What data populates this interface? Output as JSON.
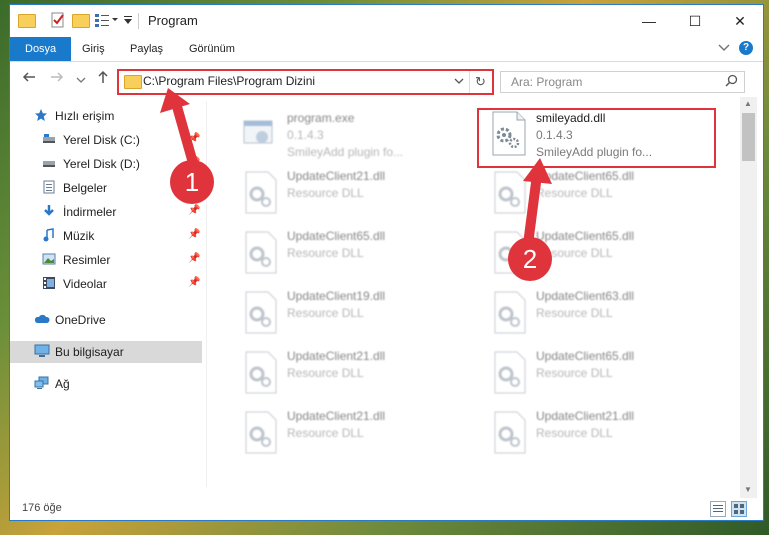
{
  "window": {
    "title": "Program"
  },
  "titlebar": {
    "minimize": "—",
    "maximize": "☐",
    "close": "✕"
  },
  "ribbon": {
    "tabs": [
      {
        "label": "Dosya"
      },
      {
        "label": "Giriş"
      },
      {
        "label": "Paylaş"
      },
      {
        "label": "Görünüm"
      }
    ],
    "collapse_icon": "chevron-down-icon",
    "help_label": "?"
  },
  "navbar": {
    "address_path": "C:\\Program Files\\Program Dizini",
    "search_placeholder": "Ara: Program"
  },
  "sidebar": {
    "items": [
      {
        "label": "Hızlı erişim",
        "icon": "star-icon"
      },
      {
        "label": "Yerel Disk (C:)",
        "icon": "drive-icon"
      },
      {
        "label": "Yerel Disk (D:)",
        "icon": "drive-icon"
      },
      {
        "label": "Belgeler",
        "icon": "documents-icon"
      },
      {
        "label": "İndirmeler",
        "icon": "download-icon"
      },
      {
        "label": "Müzik",
        "icon": "music-icon"
      },
      {
        "label": "Resimler",
        "icon": "pictures-icon"
      },
      {
        "label": "Videolar",
        "icon": "video-icon"
      },
      {
        "label": "OneDrive",
        "icon": "cloud-icon"
      },
      {
        "label": "Bu bilgisayar",
        "icon": "computer-icon"
      },
      {
        "label": "Ağ",
        "icon": "network-icon"
      }
    ]
  },
  "files": [
    {
      "name": "program.exe",
      "meta1": "0.1.4.3",
      "meta2": "SmileyAdd plugin fo..."
    },
    {
      "name": "smileyadd.dll",
      "meta1": "0.1.4.3",
      "meta2": "SmileyAdd plugin fo..."
    },
    {
      "name": "UpdateClient21.dll",
      "meta1": "Resource DLL"
    },
    {
      "name": "UpdateClient65.dll",
      "meta1": "Resource DLL"
    },
    {
      "name": "UpdateClient65.dll",
      "meta1": "Resource DLL"
    },
    {
      "name": "UpdateClient65.dll",
      "meta1": "Resource DLL"
    },
    {
      "name": "UpdateClient19.dll",
      "meta1": "Resource DLL"
    },
    {
      "name": "UpdateClient63.dll",
      "meta1": "Resource DLL"
    },
    {
      "name": "UpdateClient21.dll",
      "meta1": "Resource DLL"
    },
    {
      "name": "UpdateClient65.dll",
      "meta1": "Resource DLL"
    },
    {
      "name": "UpdateClient21.dll",
      "meta1": "Resource DLL"
    },
    {
      "name": "UpdateClient21.dll",
      "meta1": "Resource DLL"
    }
  ],
  "status": {
    "item_count": "176 öğe"
  },
  "callouts": [
    {
      "label": "1"
    },
    {
      "label": "2"
    }
  ],
  "colors": {
    "accent": "#1979ca",
    "highlight": "#e0343d",
    "selected": "#d9d9d9"
  }
}
